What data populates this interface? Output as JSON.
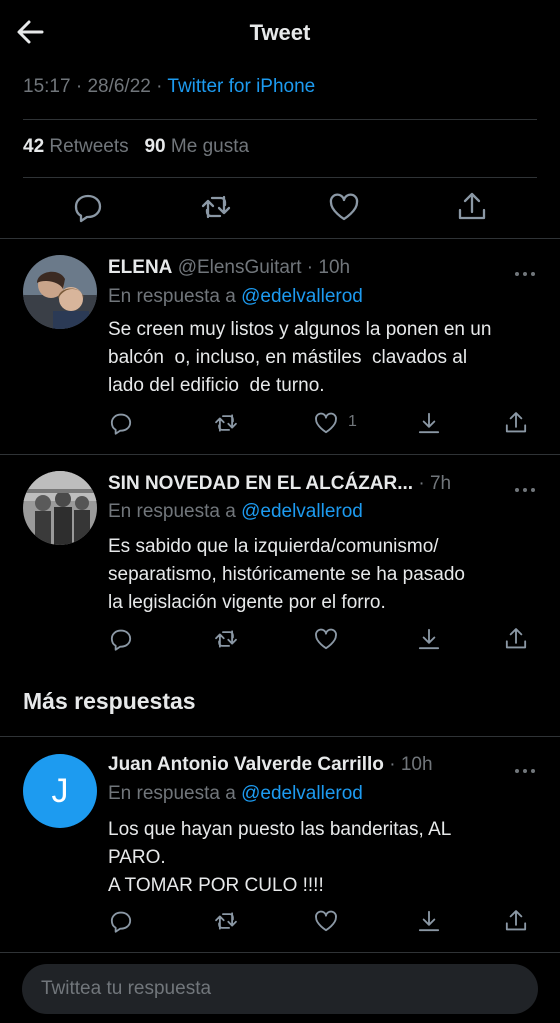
{
  "header": {
    "title": "Tweet"
  },
  "tweet": {
    "time": "15:17",
    "date": "28/6/22",
    "source": "Twitter for iPhone",
    "retweets_count": "42",
    "retweets_label": "Retweets",
    "likes_count": "90",
    "likes_label": "Me gusta"
  },
  "replies": [
    {
      "name": "ELENA",
      "handle": "@ElensGuitart",
      "time": "10h",
      "reply_to_label": "En respuesta a",
      "reply_to": "@edelvallerod",
      "text": "Se creen muy listos y algunos la ponen en un\nbalcón  o, incluso, en mástiles  clavados al\nlado del edificio  de turno.",
      "likes": "1"
    },
    {
      "name": "SIN NOVEDAD EN EL ALCÁZAR...",
      "handle": "",
      "time": "7h",
      "reply_to_label": "En respuesta a",
      "reply_to": "@edelvallerod",
      "text": "Es sabido que la izquierda/comunismo/\nseparatismo, históricamente se ha pasado\nla legislación vigente por el forro.",
      "likes": ""
    },
    {
      "name": "Juan Antonio Valverde Carrillo",
      "handle": "",
      "time": "10h",
      "avatar_letter": "J",
      "reply_to_label": "En respuesta a",
      "reply_to": "@edelvallerod",
      "text": "Los que hayan puesto las banderitas, AL\nPARO.\nA TOMAR POR CULO !!!!",
      "likes": ""
    }
  ],
  "section": {
    "more_replies": "Más respuestas"
  },
  "composer": {
    "placeholder": "Twittea tu respuesta"
  },
  "colors": {
    "accent": "#1d9bf0",
    "muted": "#71767b",
    "text": "#e7e9ea",
    "divider": "#2f3336"
  }
}
